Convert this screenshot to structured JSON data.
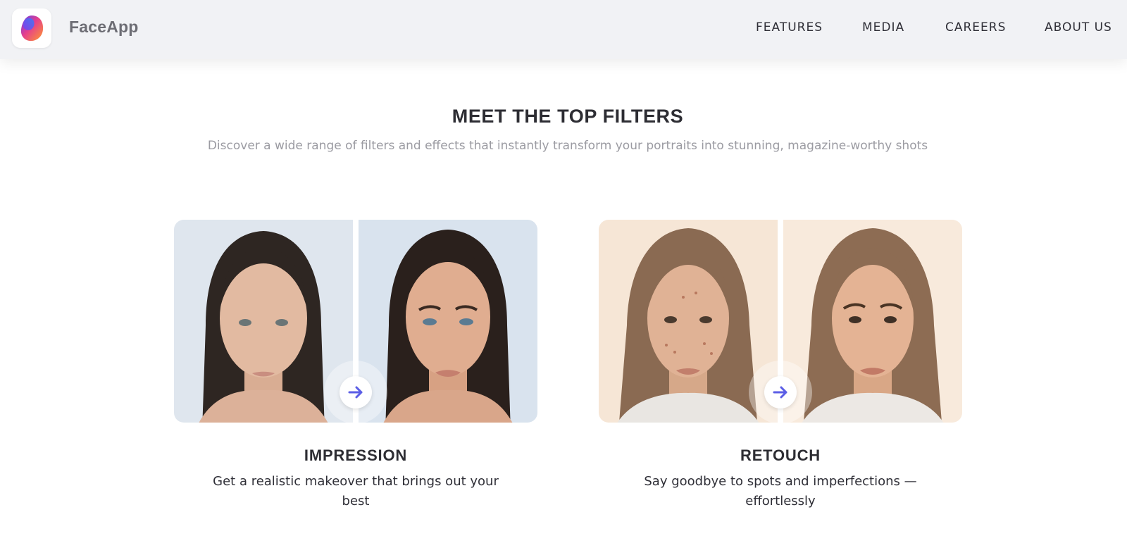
{
  "header": {
    "brand": "FaceApp",
    "logo_icon": "faceapp-logo-icon",
    "nav": [
      {
        "label": "FEATURES"
      },
      {
        "label": "MEDIA"
      },
      {
        "label": "CAREERS"
      },
      {
        "label": "ABOUT US"
      }
    ]
  },
  "section": {
    "title": "MEET THE TOP FILTERS",
    "subtitle": "Discover a wide range of filters and effects that instantly transform your portraits into stunning, magazine-worthy shots"
  },
  "filters": [
    {
      "title": "IMPRESSION",
      "description": "Get a realistic makeover that brings out your best",
      "arrow_icon": "arrow-right-icon"
    },
    {
      "title": "RETOUCH",
      "description": "Say goodbye to spots and imperfections — effortlessly",
      "arrow_icon": "arrow-right-icon"
    }
  ],
  "colors": {
    "header_bg": "#f1f2f5",
    "arrow_accent": "#5b5ee6",
    "text_dark": "#2f2f37",
    "text_muted": "#9b9ba2"
  }
}
